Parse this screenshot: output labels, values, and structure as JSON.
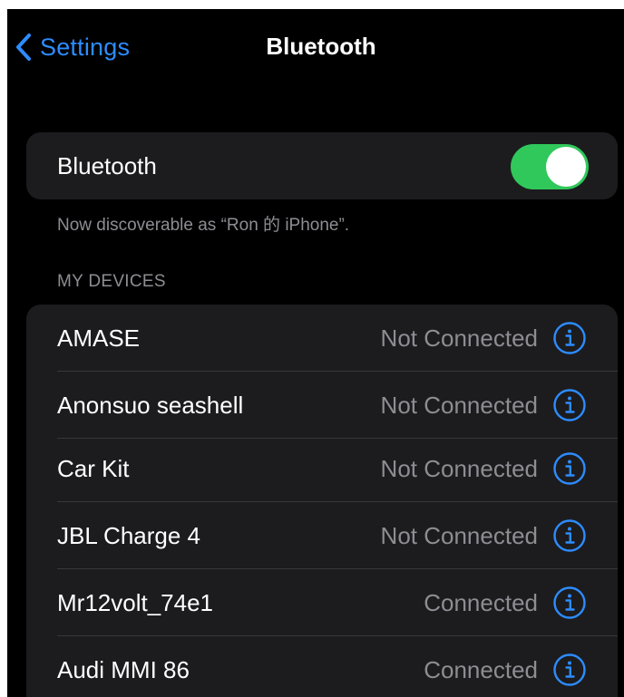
{
  "nav": {
    "back_label": "Settings",
    "title": "Bluetooth"
  },
  "bluetooth": {
    "label": "Bluetooth",
    "enabled": true,
    "discoverable_text": "Now discoverable as “Ron 的 iPhone”."
  },
  "my_devices": {
    "header": "MY DEVICES",
    "items": [
      {
        "name": "AMASE",
        "status": "Not Connected"
      },
      {
        "name": "Anonsuo seashell",
        "status": "Not Connected"
      },
      {
        "name": "Car Kit",
        "status": "Not Connected"
      },
      {
        "name": "JBL Charge 4",
        "status": "Not Connected"
      },
      {
        "name": "Mr12volt_74e1",
        "status": "Connected"
      },
      {
        "name": "Audi MMI 86",
        "status": "Connected"
      }
    ]
  },
  "icons": {
    "back": "chevron-left-icon",
    "info": "info-circle-icon"
  },
  "colors": {
    "accent": "#2d8cff",
    "switch_on": "#30c85b",
    "background": "#000000",
    "cell": "#1c1c1e",
    "secondary_text": "#8d8d93"
  }
}
